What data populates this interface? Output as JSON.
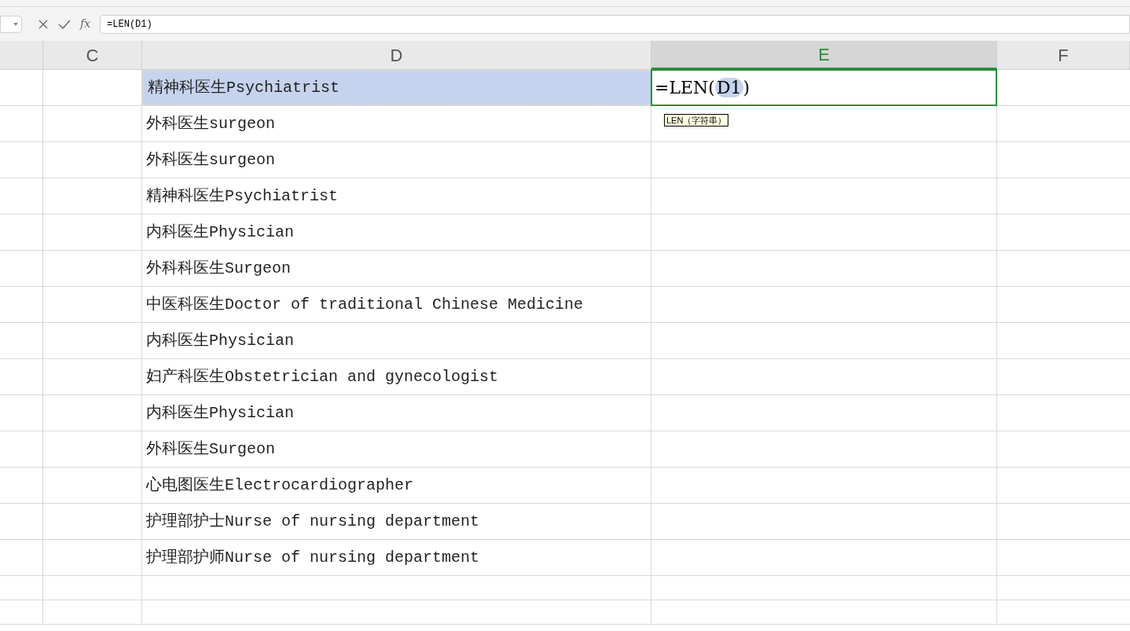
{
  "formula_bar": {
    "function_label": "fx",
    "value": "=LEN(D1)"
  },
  "columns": [
    {
      "selected": false
    },
    {
      "label": "C",
      "selected": false
    },
    {
      "label": "D",
      "selected": false
    },
    {
      "label": "E",
      "selected": true
    },
    {
      "label": "F",
      "selected": false
    }
  ],
  "rows": [
    {
      "d": "精神科医生Psychiatrist",
      "referenced": true
    },
    {
      "d": "外科医生surgeon",
      "referenced": false
    },
    {
      "d": "外科医生surgeon",
      "referenced": false
    },
    {
      "d": "精神科医生Psychiatrist",
      "referenced": false
    },
    {
      "d": "内科医生Physician",
      "referenced": false
    },
    {
      "d": "外科科医生Surgeon",
      "referenced": false
    },
    {
      "d": "中医科医生Doctor of traditional Chinese Medicine",
      "referenced": false
    },
    {
      "d": "内科医生Physician",
      "referenced": false
    },
    {
      "d": "妇产科医生Obstetrician and gynecologist",
      "referenced": false
    },
    {
      "d": "内科医生Physician",
      "referenced": false
    },
    {
      "d": "外科医生Surgeon",
      "referenced": false
    },
    {
      "d": "心电图医生Electrocardiographer",
      "referenced": false
    },
    {
      "d": "护理部护士Nurse of nursing department",
      "referenced": false
    },
    {
      "d": "护理部护师Nurse of nursing department",
      "referenced": false
    },
    {
      "referenced": false
    },
    {
      "referenced": false
    }
  ],
  "editing_cell": {
    "prefix": "=LEN(",
    "reference": "D1",
    "suffix": ")"
  },
  "tooltip": "LEN（字符串）"
}
